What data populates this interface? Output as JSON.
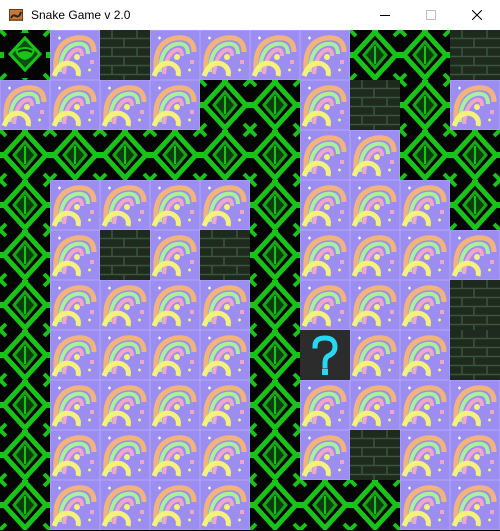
{
  "window": {
    "title": "Snake Game v 2.0",
    "icon": "snake-app-icon",
    "controls": [
      "minimize-icon",
      "maximize-icon",
      "close-icon"
    ]
  },
  "colors": {
    "vine_dark": "#0c3d0c",
    "vine_bright": "#19c419",
    "vine_background": "#040404",
    "psychedelic_base": "#9b8ef0",
    "swirl_yellow": "#f4f27a",
    "swirl_green": "#a8f09a",
    "swirl_pink": "#f2a6c8",
    "swirl_orange": "#f2b47a",
    "brick_dark": "#1d2a1d",
    "brick_line": "#3a553a",
    "mystery_box": "#2c2c2c",
    "question_mark": "#27d8f2"
  },
  "board": {
    "cols": 10,
    "rows": 10,
    "legend": {
      "V": "vine",
      "F": "psychedelic-floor",
      "B": "brick-wall",
      "Q": "mystery-box",
      "H": "snake-head"
    },
    "grid": [
      "HFBFFFFVVB",
      "FFFFVVFBVF",
      "VVVVVVFFVV",
      "VFFFFVFFFV",
      "VFBFBVFFFF",
      "VFFFFVFFFB",
      "VFFFFVQFFB",
      "VFFFFVFFFF",
      "VFFFFVFBFF",
      "VFFFFVVVFF"
    ]
  }
}
